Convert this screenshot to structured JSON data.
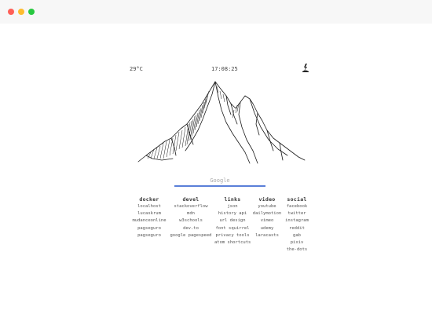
{
  "top": {
    "temperature": "29°C",
    "time": "17:08:25",
    "weather_icon": "storm-icon"
  },
  "search": {
    "placeholder": "Google"
  },
  "columns": [
    {
      "title": "docker",
      "items": [
        "localhost",
        "lucaskrum",
        "mudanceonline",
        "pagseguro",
        "pagseguro"
      ]
    },
    {
      "title": "devel",
      "items": [
        "stackoverflow",
        "mdn",
        "w3schools",
        "dev.to",
        "google pagespeed"
      ]
    },
    {
      "title": "links",
      "items": [
        "json",
        "history api",
        "url design",
        "font squirrel",
        "privacy tools",
        "atom shortcuts"
      ]
    },
    {
      "title": "video",
      "items": [
        "youtube",
        "dailymotion",
        "vimeo",
        "udemy",
        "laracasts"
      ]
    },
    {
      "title": "social",
      "items": [
        "facebook",
        "twitter",
        "instagram",
        "reddit",
        "gab",
        "pixiv",
        "the-dots"
      ]
    }
  ]
}
